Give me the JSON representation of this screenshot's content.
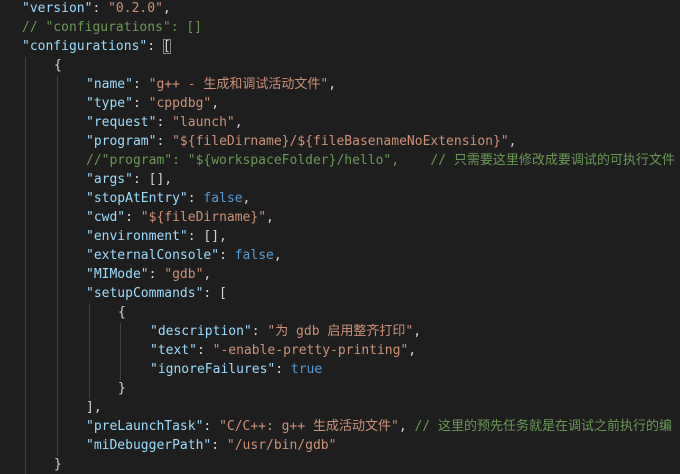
{
  "theme": {
    "background": "#1e1e1e",
    "key_color": "#9cdcfe",
    "string_color": "#ce9178",
    "comment_color": "#6a9955",
    "boolean_color": "#569cd6",
    "punctuation_color": "#d4d4d4"
  },
  "lines": [
    {
      "indent": 0,
      "tokens": [
        {
          "t": "k",
          "v": "\"version\""
        },
        {
          "t": "p",
          "v": ": "
        },
        {
          "t": "s",
          "v": "\"0.2.0\""
        },
        {
          "t": "p",
          "v": ","
        }
      ]
    },
    {
      "indent": 0,
      "tokens": [
        {
          "t": "c",
          "v": "// \"configurations\": []"
        }
      ]
    },
    {
      "indent": 0,
      "tokens": [
        {
          "t": "k",
          "v": "\"configurations\""
        },
        {
          "t": "p",
          "v": ": "
        },
        {
          "t": "pb",
          "v": "["
        }
      ]
    },
    {
      "indent": 1,
      "tokens": [
        {
          "t": "p",
          "v": "{"
        }
      ]
    },
    {
      "indent": 2,
      "tokens": [
        {
          "t": "k",
          "v": "\"name\""
        },
        {
          "t": "p",
          "v": ": "
        },
        {
          "t": "s",
          "v": "\"g++ - 生成和调试活动文件\""
        },
        {
          "t": "p",
          "v": ","
        }
      ]
    },
    {
      "indent": 2,
      "tokens": [
        {
          "t": "k",
          "v": "\"type\""
        },
        {
          "t": "p",
          "v": ": "
        },
        {
          "t": "s",
          "v": "\"cppdbg\""
        },
        {
          "t": "p",
          "v": ","
        }
      ]
    },
    {
      "indent": 2,
      "tokens": [
        {
          "t": "k",
          "v": "\"request\""
        },
        {
          "t": "p",
          "v": ": "
        },
        {
          "t": "s",
          "v": "\"launch\""
        },
        {
          "t": "p",
          "v": ","
        }
      ]
    },
    {
      "indent": 2,
      "tokens": [
        {
          "t": "k",
          "v": "\"program\""
        },
        {
          "t": "p",
          "v": ": "
        },
        {
          "t": "s",
          "v": "\"${fileDirname}/${fileBasenameNoExtension}\""
        },
        {
          "t": "p",
          "v": ","
        }
      ]
    },
    {
      "indent": 2,
      "tokens": [
        {
          "t": "c",
          "v": "//\"program\": \"${workspaceFolder}/hello\",    // 只需要这里修改成要调试的可执行文件"
        }
      ]
    },
    {
      "indent": 2,
      "tokens": [
        {
          "t": "k",
          "v": "\"args\""
        },
        {
          "t": "p",
          "v": ": [],"
        }
      ]
    },
    {
      "indent": 2,
      "tokens": [
        {
          "t": "k",
          "v": "\"stopAtEntry\""
        },
        {
          "t": "p",
          "v": ": "
        },
        {
          "t": "b",
          "v": "false"
        },
        {
          "t": "p",
          "v": ","
        }
      ]
    },
    {
      "indent": 2,
      "tokens": [
        {
          "t": "k",
          "v": "\"cwd\""
        },
        {
          "t": "p",
          "v": ": "
        },
        {
          "t": "s",
          "v": "\"${fileDirname}\""
        },
        {
          "t": "p",
          "v": ","
        }
      ]
    },
    {
      "indent": 2,
      "tokens": [
        {
          "t": "k",
          "v": "\"environment\""
        },
        {
          "t": "p",
          "v": ": [],"
        }
      ]
    },
    {
      "indent": 2,
      "tokens": [
        {
          "t": "k",
          "v": "\"externalConsole\""
        },
        {
          "t": "p",
          "v": ": "
        },
        {
          "t": "b",
          "v": "false"
        },
        {
          "t": "p",
          "v": ","
        }
      ]
    },
    {
      "indent": 2,
      "tokens": [
        {
          "t": "k",
          "v": "\"MIMode\""
        },
        {
          "t": "p",
          "v": ": "
        },
        {
          "t": "s",
          "v": "\"gdb\""
        },
        {
          "t": "p",
          "v": ","
        }
      ]
    },
    {
      "indent": 2,
      "tokens": [
        {
          "t": "k",
          "v": "\"setupCommands\""
        },
        {
          "t": "p",
          "v": ": ["
        }
      ]
    },
    {
      "indent": 3,
      "tokens": [
        {
          "t": "p",
          "v": "{"
        }
      ]
    },
    {
      "indent": 4,
      "tokens": [
        {
          "t": "k",
          "v": "\"description\""
        },
        {
          "t": "p",
          "v": ": "
        },
        {
          "t": "s",
          "v": "\"为 gdb 启用整齐打印\""
        },
        {
          "t": "p",
          "v": ","
        }
      ]
    },
    {
      "indent": 4,
      "tokens": [
        {
          "t": "k",
          "v": "\"text\""
        },
        {
          "t": "p",
          "v": ": "
        },
        {
          "t": "s",
          "v": "\"-enable-pretty-printing\""
        },
        {
          "t": "p",
          "v": ","
        }
      ]
    },
    {
      "indent": 4,
      "tokens": [
        {
          "t": "k",
          "v": "\"ignoreFailures\""
        },
        {
          "t": "p",
          "v": ": "
        },
        {
          "t": "b",
          "v": "true"
        }
      ]
    },
    {
      "indent": 3,
      "tokens": [
        {
          "t": "p",
          "v": "}"
        }
      ]
    },
    {
      "indent": 2,
      "tokens": [
        {
          "t": "p",
          "v": "],"
        }
      ]
    },
    {
      "indent": 2,
      "tokens": [
        {
          "t": "k",
          "v": "\"preLaunchTask\""
        },
        {
          "t": "p",
          "v": ": "
        },
        {
          "t": "s",
          "v": "\"C/C++: g++ 生成活动文件\""
        },
        {
          "t": "p",
          "v": ", "
        },
        {
          "t": "c",
          "v": "// 这里的预先任务就是在调试之前执行的编"
        }
      ]
    },
    {
      "indent": 2,
      "tokens": [
        {
          "t": "k",
          "v": "\"miDebuggerPath\""
        },
        {
          "t": "p",
          "v": ": "
        },
        {
          "t": "s",
          "v": "\"/usr/bin/gdb\""
        }
      ]
    },
    {
      "indent": 1,
      "tokens": [
        {
          "t": "p",
          "v": "}"
        }
      ]
    }
  ]
}
